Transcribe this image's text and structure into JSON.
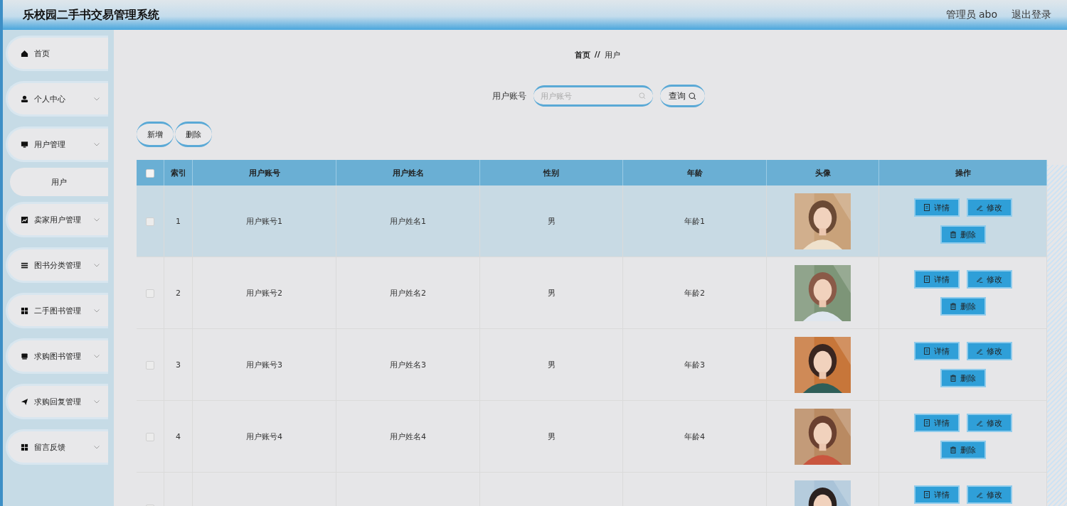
{
  "header": {
    "title": "乐校园二手书交易管理系统",
    "user": "管理员 abo",
    "logout": "退出登录"
  },
  "sidebar": {
    "items": [
      {
        "label": "首页",
        "kind": "link"
      },
      {
        "label": "个人中心",
        "kind": "menu"
      },
      {
        "label": "用户管理",
        "kind": "menu",
        "children": [
          {
            "label": "用户"
          }
        ]
      },
      {
        "label": "卖家用户管理",
        "kind": "menu"
      },
      {
        "label": "图书分类管理",
        "kind": "menu"
      },
      {
        "label": "二手图书管理",
        "kind": "menu"
      },
      {
        "label": "求购图书管理",
        "kind": "menu"
      },
      {
        "label": "求购回复管理",
        "kind": "menu"
      },
      {
        "label": "留言反馈",
        "kind": "menu"
      }
    ]
  },
  "breadcrumb": [
    "首页",
    "//",
    "用户"
  ],
  "search": {
    "label": "用户账号",
    "placeholder": "用户账号",
    "button": "查询"
  },
  "toolbar": [
    "新增",
    "删除"
  ],
  "table": {
    "columns": [
      "索引",
      "用户账号",
      "用户姓名",
      "性别",
      "年龄",
      "头像",
      "操作"
    ],
    "header_checked": false,
    "rows": [
      {
        "index": "1",
        "account": "用户账号1",
        "name": "用户姓名1",
        "gender": "男",
        "age": "年龄1",
        "checked": false,
        "selected": true,
        "avatar": {
          "kind": "picture"
        },
        "actions": [
          "详情",
          "修改",
          "删除"
        ]
      },
      {
        "index": "2",
        "account": "用户账号2",
        "name": "用户姓名2",
        "gender": "男",
        "age": "年龄2",
        "checked": false,
        "selected": false,
        "avatar": {
          "kind": "picture"
        },
        "actions": [
          "详情",
          "修改",
          "删除"
        ]
      },
      {
        "index": "3",
        "account": "用户账号3",
        "name": "用户姓名3",
        "gender": "男",
        "age": "年龄3",
        "checked": false,
        "selected": false,
        "avatar": {
          "kind": "picture"
        },
        "actions": [
          "详情",
          "修改",
          "删除"
        ]
      },
      {
        "index": "4",
        "account": "用户账号4",
        "name": "用户姓名4",
        "gender": "男",
        "age": "年龄4",
        "checked": false,
        "selected": false,
        "avatar": {
          "kind": "picture"
        },
        "actions": [
          "详情",
          "修改",
          "删除"
        ]
      },
      {
        "checked": false,
        "selected": false,
        "avatar": {
          "kind": "picture"
        },
        "actions": [
          "详情",
          "修改"
        ]
      }
    ]
  }
}
